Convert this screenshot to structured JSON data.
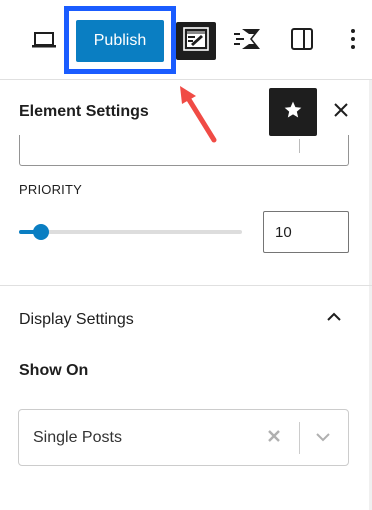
{
  "toolbar": {
    "publish_label": "Publish",
    "icons": [
      "desktop-icon",
      "plugin-icon",
      "spectra-icon",
      "sidebar-toggle-icon",
      "more-vertical-icon"
    ]
  },
  "element_settings": {
    "title": "Element Settings",
    "priority_label": "PRIORITY",
    "priority_value": "10",
    "priority_slider_fraction": 0.1
  },
  "display_settings": {
    "title": "Display Settings",
    "show_on_label": "Show On",
    "show_on_value": "Single Posts"
  },
  "colors": {
    "accent": "#0a7ec2",
    "highlight": "#1a5cff",
    "arrow": "#f04b45",
    "dark": "#1e1e1e"
  }
}
